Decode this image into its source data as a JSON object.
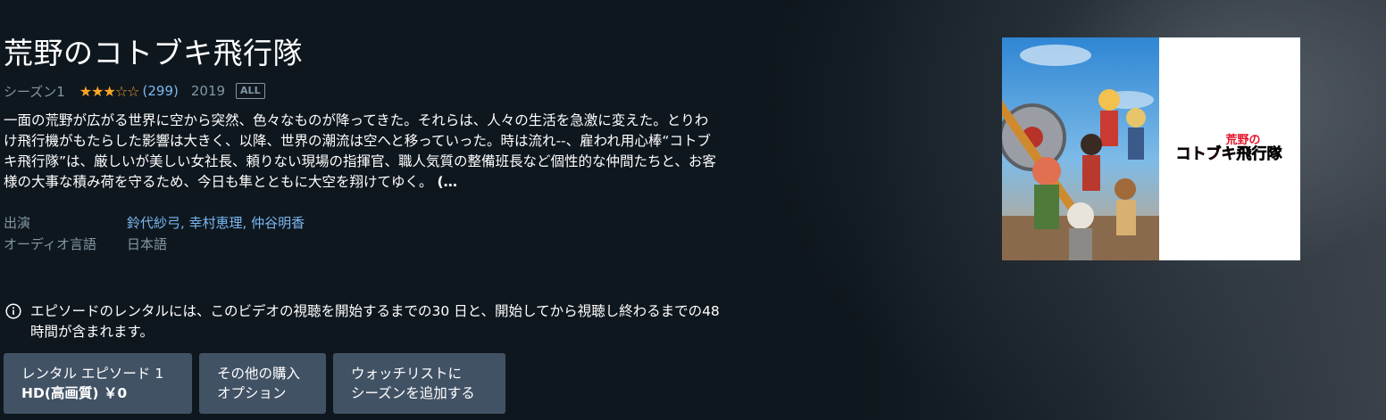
{
  "title": "荒野のコトブキ飛行隊",
  "meta": {
    "season": "シーズン1",
    "stars_filled": "★★★",
    "stars_empty": "☆☆",
    "rating_value": 3,
    "rating_max": 5,
    "rating_count": "(299)",
    "year": "2019",
    "badge": "ALL"
  },
  "synopsis": {
    "text": "一面の荒野が広がる世界に空から突然、色々なものが降ってきた。それらは、人々の生活を急激に変えた。とりわけ飛行機がもたらした影響は大きく、以降、世界の潮流は空へと移っていった。時は流れ--、雇われ用心棒“コトブキ飛行隊”は、厳しいが美しい女社長、頼りない現場の指揮官、職人気質の整備班長など個性的な仲間たちと、お客様の大事な積み荷を守るため、今日も隼とともに大空を翔けてゆく。",
    "more": "(…"
  },
  "details": {
    "cast_label": "出演",
    "cast_value": "鈴代紗弓, 幸村恵理, 仲谷明香",
    "audio_label": "オーディオ言語",
    "audio_value": "日本語"
  },
  "notice": {
    "icon": "info-icon",
    "text": "エピソードのレンタルには、このビデオの視聴を開始するまでの30 日と、開始してから視聴し終わるまでの48 時間が含まれます。"
  },
  "buttons": {
    "rent_line1": "レンタル エピソード 1",
    "rent_line2": "HD(高画質) ￥0",
    "other_line1": "その他の購入",
    "other_line2": "オプション",
    "watchlist_line1": "ウォッチリストに",
    "watchlist_line2": "シーズンを追加する"
  },
  "poster": {
    "logo_small": "荒野の",
    "logo_main": "コトブキ飛行隊"
  },
  "colors": {
    "background": "#0f171e",
    "accent_link": "#79b8f3",
    "muted_text": "#8197a4",
    "star": "#ffa724",
    "button": "#425265",
    "logo_red": "#e3142a"
  }
}
